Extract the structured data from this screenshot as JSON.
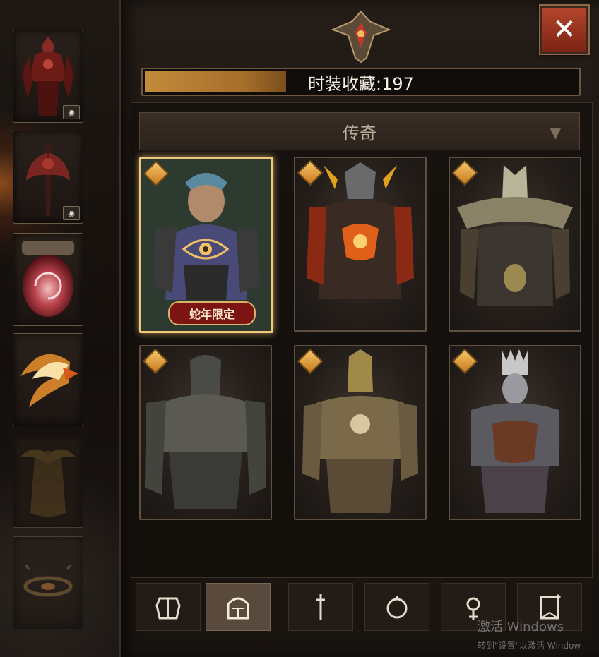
{
  "header": {
    "collection_label": "时装收藏:197",
    "collection_count": 197
  },
  "filter": {
    "selected": "传奇"
  },
  "sidebar": {
    "slots": [
      {
        "name": "armor-set",
        "has_preview_toggle": true
      },
      {
        "name": "weapon",
        "has_preview_toggle": true
      },
      {
        "name": "portal-effect",
        "has_preview_toggle": false
      },
      {
        "name": "wings",
        "has_preview_toggle": false
      },
      {
        "name": "cape",
        "has_preview_toggle": false
      },
      {
        "name": "aura",
        "has_preview_toggle": false
      }
    ]
  },
  "cards": [
    {
      "name": "costume-1",
      "selected": true,
      "badge": "蛇年限定",
      "equipped": true
    },
    {
      "name": "costume-2",
      "selected": false
    },
    {
      "name": "costume-3",
      "selected": false
    },
    {
      "name": "costume-4",
      "selected": false
    },
    {
      "name": "costume-5",
      "selected": false
    },
    {
      "name": "costume-6",
      "selected": false
    }
  ],
  "tabs": [
    "armor",
    "helmet",
    "weapon",
    "ring",
    "amulet",
    "banner"
  ],
  "active_tab": 1,
  "watermark": {
    "line1": "激活 Windows",
    "line2": "转到\"设置\"以激活 Window"
  },
  "colors": {
    "accent_gold": "#c48a3c",
    "close_red": "#a63a22",
    "rarity_gem": "#e9a33f"
  }
}
